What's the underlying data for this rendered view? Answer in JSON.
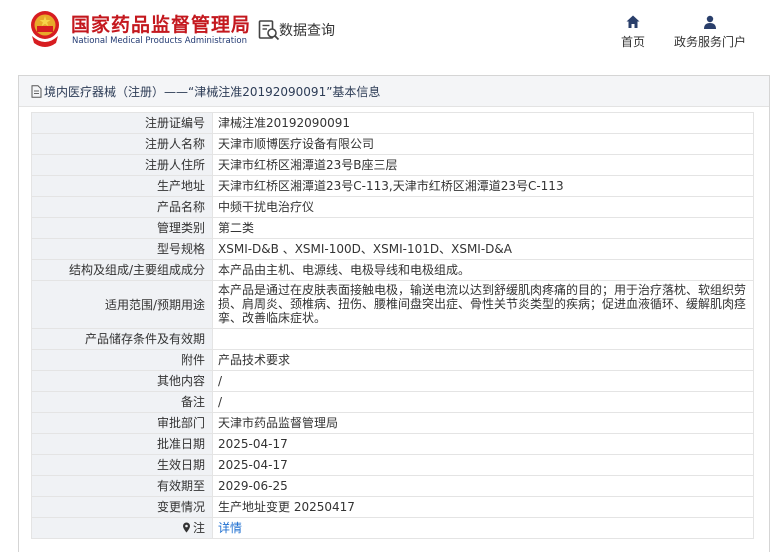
{
  "header": {
    "logo_cn": "国家药品监督管理局",
    "logo_en": "National Medical Products Administration",
    "query_label": "数据查询",
    "nav": [
      {
        "label": "首页",
        "icon": "home-icon"
      },
      {
        "label": "政务服务门户",
        "icon": "user-icon"
      }
    ]
  },
  "panel": {
    "title": "境内医疗器械（注册）——“津械注准20192090091”基本信息"
  },
  "rows": [
    {
      "label": "注册证编号",
      "value": "津械注准20192090091"
    },
    {
      "label": "注册人名称",
      "value": "天津市顺博医疗设备有限公司"
    },
    {
      "label": "注册人住所",
      "value": "天津市红桥区湘潭道23号B座三层"
    },
    {
      "label": "生产地址",
      "value": "天津市红桥区湘潭道23号C-113,天津市红桥区湘潭道23号C-113"
    },
    {
      "label": "产品名称",
      "value": "中频干扰电治疗仪"
    },
    {
      "label": "管理类别",
      "value": "第二类"
    },
    {
      "label": "型号规格",
      "value": "XSMI-D&B 、XSMI-100D、XSMI-101D、XSMI-D&A"
    },
    {
      "label": "结构及组成/主要组成成分",
      "value": "本产品由主机、电源线、电极导线和电极组成。"
    },
    {
      "label": "适用范围/预期用途",
      "value": "本产品是通过在皮肤表面接触电极，输送电流以达到舒缓肌肉疼痛的目的；用于治疗落枕、软组织劳损、肩周炎、颈椎病、扭伤、腰椎间盘突出症、骨性关节炎类型的疾病；促进血液循环、缓解肌肉痉挛、改善临床症状。"
    },
    {
      "label": "产品储存条件及有效期",
      "value": ""
    },
    {
      "label": "附件",
      "value": "产品技术要求"
    },
    {
      "label": "其他内容",
      "value": "/"
    },
    {
      "label": "备注",
      "value": "/"
    },
    {
      "label": "审批部门",
      "value": "天津市药品监督管理局"
    },
    {
      "label": "批准日期",
      "value": "2025-04-17"
    },
    {
      "label": "生效日期",
      "value": "2025-04-17"
    },
    {
      "label": "有效期至",
      "value": "2029-06-25"
    },
    {
      "label": "变更情况",
      "value": "生产地址变更 20250417"
    },
    {
      "label": "注",
      "value": "详情",
      "icon": "pin-icon"
    }
  ],
  "colors": {
    "brand_red": "#c4181e",
    "brand_blue": "#223a72",
    "link": "#1e6fd0",
    "label_bg": "#f0f2f5",
    "title_bg": "#f4f5f7"
  }
}
